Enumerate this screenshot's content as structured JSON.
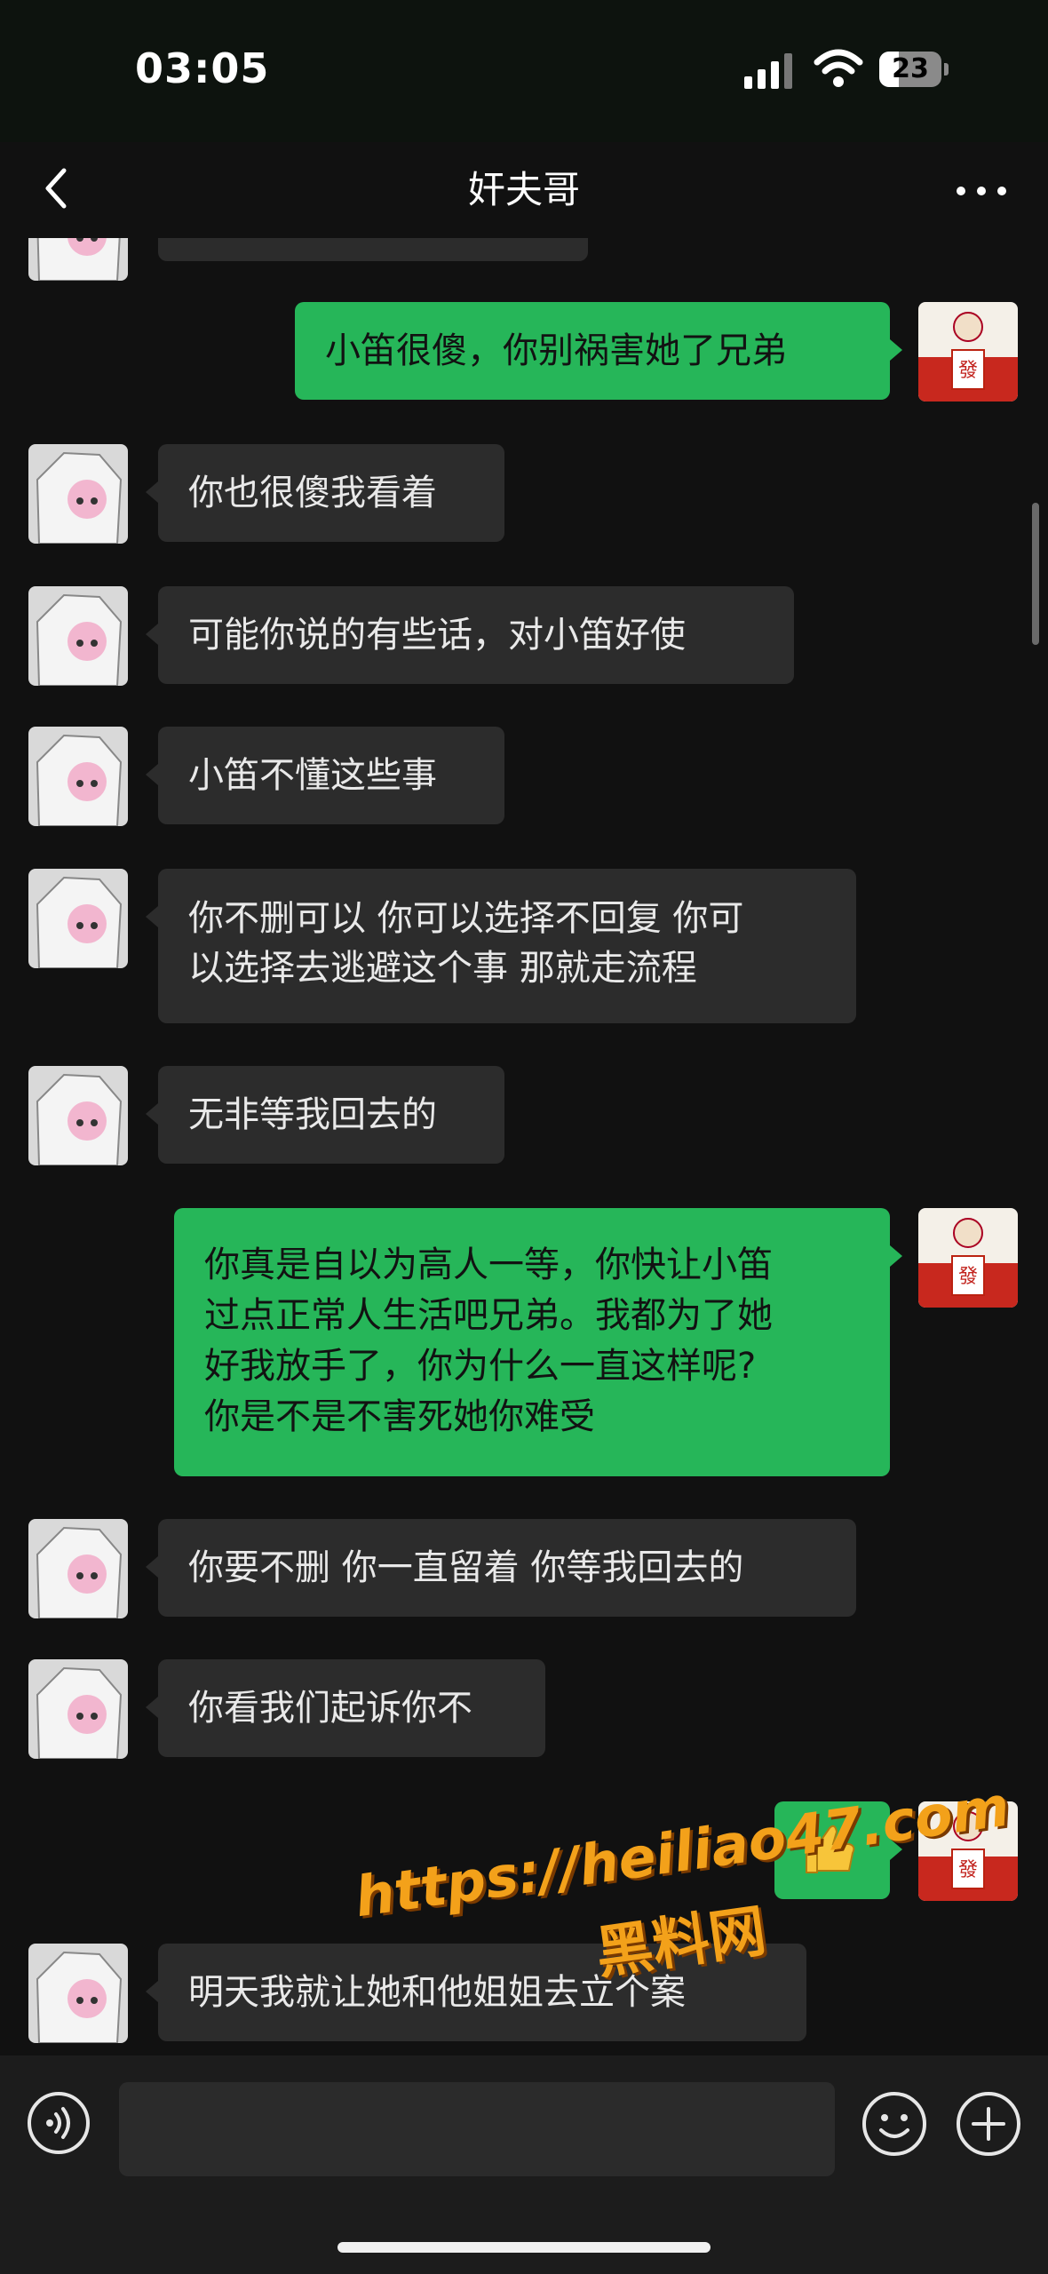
{
  "status_bar": {
    "time": "03:05",
    "battery": "23"
  },
  "header": {
    "title": "奸夫哥"
  },
  "messages": [
    {
      "side": "in",
      "text": ""
    },
    {
      "side": "out",
      "text": "小笛很傻，你别祸害她了兄弟"
    },
    {
      "side": "in",
      "text": "你也很傻我看着"
    },
    {
      "side": "in",
      "text": "可能你说的有些话，对小笛好使"
    },
    {
      "side": "in",
      "text": "小笛不懂这些事"
    },
    {
      "side": "in",
      "lines": [
        "你不删可以 你可以选择不回复 你可",
        "以选择去逃避这个事 那就走流程"
      ]
    },
    {
      "side": "in",
      "text": "无非等我回去的"
    },
    {
      "side": "out",
      "lines": [
        "你真是自以为高人一等，你快让小笛",
        "过点正常人生活吧兄弟。我都为了她",
        "好我放手了，你为什么一直这样呢?",
        "你是不是不害死她你难受"
      ]
    },
    {
      "side": "in",
      "text": "你要不删 你一直留着 你等我回去的"
    },
    {
      "side": "in",
      "text": "你看我们起诉你不"
    },
    {
      "side": "out",
      "text": "",
      "type": "emoji-sticker"
    },
    {
      "side": "in",
      "text": "明天我就让她和他姐姐去立个案"
    }
  ],
  "watermark": {
    "url": "https://heiliao47.com",
    "name": "黑料网"
  },
  "colors": {
    "outgoing_bubble": "#26b659",
    "incoming_bubble": "#2c2c2c",
    "background": "#111111"
  },
  "icons": {
    "back": "chevron-left-icon",
    "more": "more-dots-icon",
    "voice": "voice-icon",
    "emoji": "emoji-icon",
    "plus": "plus-icon"
  }
}
